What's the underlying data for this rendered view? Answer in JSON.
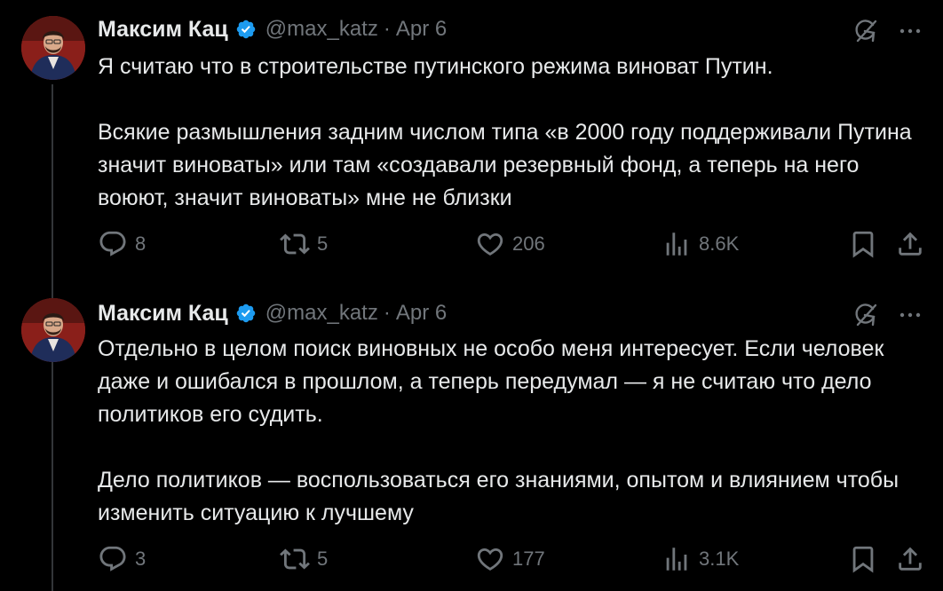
{
  "tweets": [
    {
      "author_name": "Максим Кац",
      "handle": "@max_katz",
      "separator": "·",
      "date": "Apr 6",
      "paragraphs": [
        "Я считаю что в строительстве путинского режима виноват Путин.",
        "Всякие размышления задним числом типа «в 2000 году поддерживали Путина значит виноваты» или там «создавали резервный фонд, а теперь на него воюют, значит виноваты» мне не близки"
      ],
      "replies": "8",
      "reposts": "5",
      "likes": "206",
      "views": "8.6K"
    },
    {
      "author_name": "Максим Кац",
      "handle": "@max_katz",
      "separator": "·",
      "date": "Apr 6",
      "paragraphs": [
        "Отдельно в целом поиск виновных не особо меня интересует. Если человек даже и ошибался в прошлом, а теперь передумал — я не считаю что дело политиков его судить.",
        "Дело политиков — воспользоваться его знаниями, опытом и влиянием чтобы изменить ситуацию к лучшему"
      ],
      "replies": "3",
      "reposts": "5",
      "likes": "177",
      "views": "3.1K"
    }
  ],
  "icons": {
    "verified": "verified-badge-icon",
    "grok": "grok-icon",
    "more": "more-icon",
    "reply": "reply-icon",
    "repost": "repost-icon",
    "like": "heart-icon",
    "views": "views-icon",
    "bookmark": "bookmark-icon",
    "share": "share-icon"
  },
  "colors": {
    "background": "#000000",
    "text": "#e7e9ea",
    "muted": "#71767b",
    "verified": "#1d9bf0",
    "thread_line": "#333639"
  }
}
